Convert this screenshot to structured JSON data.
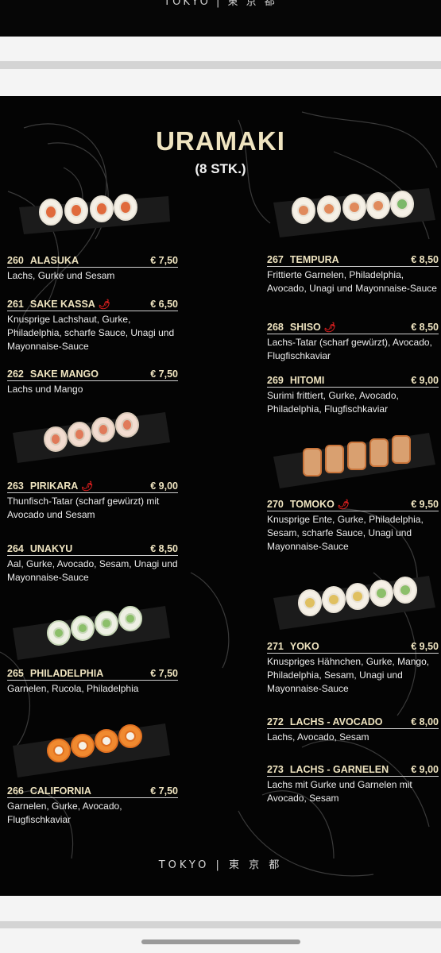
{
  "brand": "TOKYO | 東 京 都",
  "menu": {
    "title": "URAMAKI",
    "subtitle": "(8 STK.)"
  },
  "left_items": [
    {
      "number": "260",
      "name": "ALASUKA",
      "price": "€ 7,50",
      "spicy": false,
      "description": "Lachs, Gurke und Sesam"
    },
    {
      "number": "261",
      "name": "SAKE KASSA",
      "price": "€ 6,50",
      "spicy": true,
      "description": "Knusprige Lachshaut, Gurke, Philadelphia, scharfe Sauce, Unagi und Mayonnaise-Sauce"
    },
    {
      "number": "262",
      "name": "SAKE MANGO",
      "price": "€ 7,50",
      "spicy": false,
      "description": "Lachs und Mango"
    },
    {
      "number": "263",
      "name": "PIRIKARA",
      "price": "€ 9,00",
      "spicy": true,
      "description": "Thunfisch-Tatar (scharf gewürzt) mit Avocado und Sesam"
    },
    {
      "number": "264",
      "name": "UNAKYU",
      "price": "€ 8,50",
      "spicy": false,
      "description": "Aal, Gurke, Avocado, Sesam, Unagi und Mayonnaise-Sauce"
    },
    {
      "number": "265",
      "name": "PHILADELPHIA",
      "price": "€ 7,50",
      "spicy": false,
      "description": "Garnelen, Rucola, Philadelphia"
    },
    {
      "number": "266",
      "name": "CALIFORNIA",
      "price": "€ 7,50",
      "spicy": false,
      "description": "Garnelen, Gurke, Avocado, Flugfischkaviar"
    }
  ],
  "right_items": [
    {
      "number": "267",
      "name": "TEMPURA",
      "price": "€ 8,50",
      "spicy": false,
      "description": "Frittierte Garnelen, Philadelphia, Avocado, Unagi und Mayonnaise-Sauce"
    },
    {
      "number": "268",
      "name": "SHISO",
      "price": "€ 8,50",
      "spicy": true,
      "description": "Lachs-Tatar (scharf gewürzt), Avocado, Flugfischkaviar"
    },
    {
      "number": "269",
      "name": "HITOMI",
      "price": "€ 9,00",
      "spicy": false,
      "description": "Surimi frittiert, Gurke, Avocado, Philadelphia, Flugfischkaviar"
    },
    {
      "number": "270",
      "name": "TOMOKO",
      "price": "€ 9,50",
      "spicy": true,
      "description": "Knusprige Ente, Gurke, Philadelphia, Sesam, scharfe Sauce, Unagi und Mayonnaise-Sauce"
    },
    {
      "number": "271",
      "name": "YOKO",
      "price": "€ 9,50",
      "spicy": false,
      "description": "Knuspriges Hähnchen, Gurke, Mango, Philadelphia, Sesam, Unagi und Mayonnaise-Sauce"
    },
    {
      "number": "272",
      "name": "LACHS - AVOCADO",
      "price": "€ 8,00",
      "spicy": false,
      "description": "Lachs, Avocado, Sesam"
    },
    {
      "number": "273",
      "name": "LACHS - GARNELEN",
      "price": "€ 9,00",
      "spicy": false,
      "description": "Lachs mit Gurke und Garnelen mit Avocado, Sesam"
    }
  ],
  "icons": {
    "spicy": "chili-pepper-icon"
  },
  "colors": {
    "gold": "#efe4c0",
    "chili": "#d81e1e",
    "background": "#040404"
  }
}
